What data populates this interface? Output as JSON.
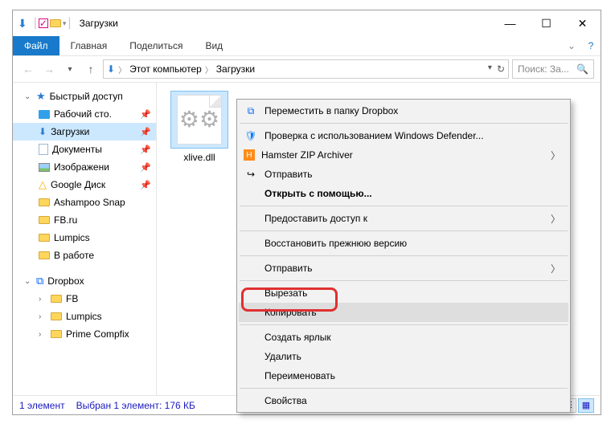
{
  "titlebar": {
    "title": "Загрузки"
  },
  "ribbon": {
    "file": "Файл",
    "home": "Главная",
    "share": "Поделиться",
    "view": "Вид"
  },
  "breadcrumb": {
    "root": "Этот компьютер",
    "current": "Загрузки"
  },
  "search": {
    "placeholder": "Поиск: За..."
  },
  "tree": {
    "quickaccess": "Быстрый доступ",
    "desktop": "Рабочий сто.",
    "downloads": "Загрузки",
    "documents": "Документы",
    "pictures": "Изображени",
    "gdrive": "Google Диск",
    "ashampoo": "Ashampoo Snap",
    "fbru": "FB.ru",
    "lumpics": "Lumpics",
    "vrabote": "В работе",
    "dropbox": "Dropbox",
    "fb": "FB",
    "lumpics2": "Lumpics",
    "primecompfix": "Prime Compfix"
  },
  "file": {
    "name": "xlive.dll"
  },
  "status": {
    "count": "1 элемент",
    "selection": "Выбран 1 элемент: 176 КБ"
  },
  "context": {
    "dropbox": "Переместить в папку Dropbox",
    "defender": "Проверка с использованием Windows Defender...",
    "hamster": "Hamster ZIP Archiver",
    "sendto": "Отправить",
    "openwith": "Открыть с помощью...",
    "grantaccess": "Предоставить доступ к",
    "restore": "Восстановить прежнюю версию",
    "sendto2": "Отправить",
    "cut": "Вырезать",
    "copy": "Копировать",
    "shortcut": "Создать ярлык",
    "delete": "Удалить",
    "rename": "Переименовать",
    "properties": "Свойства"
  }
}
